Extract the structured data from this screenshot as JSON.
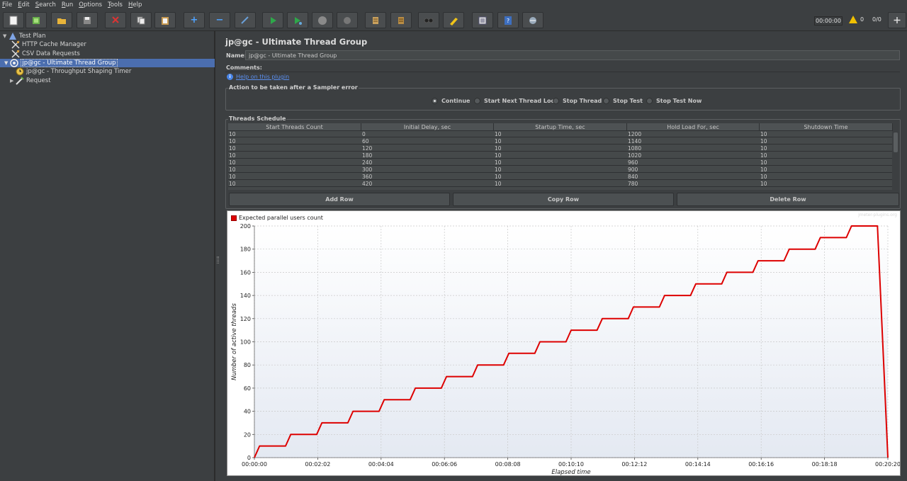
{
  "menu": [
    "File",
    "Edit",
    "Search",
    "Run",
    "Options",
    "Tools",
    "Help"
  ],
  "toolbar": {
    "buttons": [
      "new-icon",
      "templates-icon",
      "open-icon",
      "save-icon",
      "cut-icon",
      "copy-icon",
      "paste-icon",
      "expand-icon",
      "collapse-icon",
      "toggle-icon",
      "start-icon",
      "start-no-pauses-icon",
      "stop-icon",
      "shutdown-icon",
      "clear-icon",
      "clear-all-icon",
      "search-icon",
      "reset-search-icon",
      "function-helper-icon",
      "help-icon",
      "remote-icon"
    ],
    "timer": "00:00:00",
    "warnings": "0",
    "threads_ratio": "0/0"
  },
  "tree": {
    "items": [
      {
        "label": "Test Plan",
        "icon": "test-plan-icon"
      },
      {
        "label": "HTTP Cache Manager",
        "icon": "config-icon"
      },
      {
        "label": "CSV Data Requests",
        "icon": "config-icon"
      },
      {
        "label": "jp@gc - Ultimate Thread Group",
        "icon": "thread-group-icon"
      },
      {
        "label": "jp@gc - Throughput Shaping Timer",
        "icon": "timer-icon"
      },
      {
        "label": "Request",
        "icon": "sampler-icon"
      }
    ]
  },
  "panel": {
    "title": "jp@gc - Ultimate Thread Group",
    "name_label": "Name:",
    "name_value": "jp@gc - Ultimate Thread Group",
    "comments_label": "Comments:",
    "help_link": "Help on this plugin",
    "action_legend": "Action to be taken after a Sampler error",
    "actions": [
      "Continue",
      "Start Next Thread Loop",
      "Stop Thread",
      "Stop Test",
      "Stop Test Now"
    ],
    "selected_action": "Continue",
    "schedule_legend": "Threads Schedule",
    "columns": [
      "Start Threads Count",
      "Initial Delay, sec",
      "Startup Time, sec",
      "Hold Load For, sec",
      "Shutdown Time"
    ],
    "rows": [
      [
        "10",
        "0",
        "10",
        "1200",
        "10"
      ],
      [
        "10",
        "60",
        "10",
        "1140",
        "10"
      ],
      [
        "10",
        "120",
        "10",
        "1080",
        "10"
      ],
      [
        "10",
        "180",
        "10",
        "1020",
        "10"
      ],
      [
        "10",
        "240",
        "10",
        "960",
        "10"
      ],
      [
        "10",
        "300",
        "10",
        "900",
        "10"
      ],
      [
        "10",
        "360",
        "10",
        "840",
        "10"
      ],
      [
        "10",
        "420",
        "10",
        "780",
        "10"
      ]
    ],
    "add_row": "Add Row",
    "copy_row": "Copy Row",
    "delete_row": "Delete Row"
  },
  "chart_data": {
    "type": "line",
    "title": "",
    "watermark": "jmeter-plugins.org",
    "xlabel": "Elapsed time",
    "ylabel": "Number of active threads",
    "ylim": [
      0,
      200
    ],
    "yticks": [
      0,
      20,
      40,
      60,
      80,
      100,
      120,
      140,
      160,
      180,
      200
    ],
    "xticks": [
      "00:00:00",
      "00:02:02",
      "00:04:04",
      "00:06:06",
      "00:08:08",
      "00:10:10",
      "00:12:12",
      "00:14:14",
      "00:16:16",
      "00:18:18",
      "00:20:20"
    ],
    "xlim_sec": [
      0,
      1220
    ],
    "grid": true,
    "legend_position": "top-left",
    "series": [
      {
        "name": "Expected parallel users count",
        "color": "#dd0000",
        "x_sec": [
          0,
          10,
          60,
          70,
          120,
          130,
          180,
          190,
          240,
          250,
          300,
          310,
          360,
          370,
          420,
          430,
          480,
          490,
          540,
          550,
          600,
          610,
          660,
          670,
          720,
          730,
          780,
          790,
          840,
          850,
          900,
          910,
          960,
          970,
          1020,
          1030,
          1080,
          1090,
          1140,
          1150,
          1200,
          1210,
          1220
        ],
        "values": [
          0,
          10,
          10,
          20,
          20,
          30,
          30,
          40,
          40,
          50,
          50,
          60,
          60,
          70,
          70,
          80,
          80,
          90,
          90,
          100,
          100,
          110,
          110,
          120,
          120,
          130,
          130,
          140,
          140,
          150,
          150,
          160,
          160,
          170,
          170,
          180,
          180,
          190,
          190,
          200,
          200,
          100,
          0
        ]
      }
    ]
  }
}
